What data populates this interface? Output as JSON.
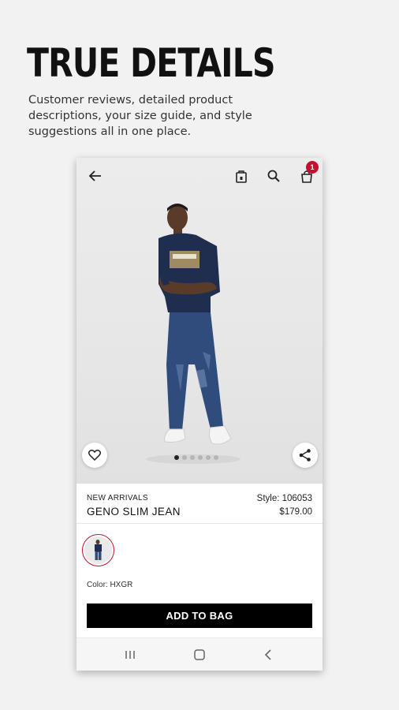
{
  "promo": {
    "headline": "TRUE DETAILS",
    "subhead": "Customer reviews, detailed product descriptions, your size guide, and style suggestions all in one place."
  },
  "topbar": {
    "back_icon": "arrow-left-icon",
    "store_icon": "store-icon",
    "search_icon": "search-icon",
    "bag_icon": "shopping-bag-icon",
    "bag_count": "1"
  },
  "gallery": {
    "image_count": 6,
    "active_index": 0,
    "favorite_icon": "heart-icon",
    "share_icon": "share-icon"
  },
  "product": {
    "category": "NEW ARRIVALS",
    "name": "GENO SLIM JEAN",
    "style": "Style: 106053",
    "price": "$179.00",
    "color_label": "Color: HXGR"
  },
  "actions": {
    "add_to_bag": "ADD TO BAG"
  },
  "system_nav": {
    "recents_icon": "recents-icon",
    "home_icon": "home-icon",
    "back_icon": "back-chevron-icon"
  },
  "colors": {
    "accent": "#c8102e",
    "button": "#000000",
    "denim": "#2f4c7c",
    "shirt": "#1f2d4f"
  }
}
